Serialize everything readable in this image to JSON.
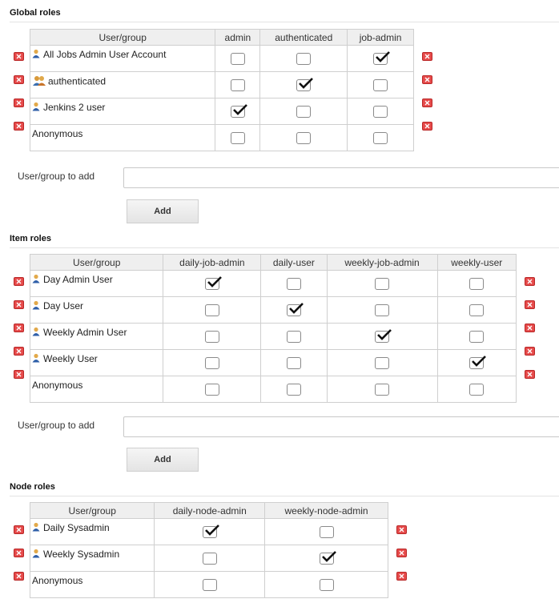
{
  "global": {
    "title": "Global roles",
    "columns": [
      "User/group",
      "admin",
      "authenticated",
      "job-admin"
    ],
    "rows": [
      {
        "name": "All Jobs Admin User Account",
        "icon": "user-icon",
        "checks": [
          false,
          false,
          true
        ]
      },
      {
        "name": "authenticated",
        "icon": "group-icon",
        "checks": [
          false,
          true,
          false
        ]
      },
      {
        "name": "Jenkins 2 user",
        "icon": "user-icon",
        "checks": [
          true,
          false,
          false
        ]
      },
      {
        "name": "Anonymous",
        "icon": "",
        "checks": [
          false,
          false,
          false
        ]
      }
    ],
    "add_label": "User/group to add",
    "add_value": "",
    "add_button": "Add"
  },
  "item": {
    "title": "Item roles",
    "columns": [
      "User/group",
      "daily-job-admin",
      "daily-user",
      "weekly-job-admin",
      "weekly-user"
    ],
    "rows": [
      {
        "name": "Day Admin User",
        "icon": "user-icon",
        "checks": [
          true,
          false,
          false,
          false
        ]
      },
      {
        "name": "Day User",
        "icon": "user-icon",
        "checks": [
          false,
          true,
          false,
          false
        ]
      },
      {
        "name": "Weekly Admin User",
        "icon": "user-icon",
        "checks": [
          false,
          false,
          true,
          false
        ]
      },
      {
        "name": "Weekly User",
        "icon": "user-icon",
        "checks": [
          false,
          false,
          false,
          true
        ]
      },
      {
        "name": "Anonymous",
        "icon": "",
        "checks": [
          false,
          false,
          false,
          false
        ]
      }
    ],
    "add_label": "User/group to add",
    "add_value": "",
    "add_button": "Add"
  },
  "node": {
    "title": "Node roles",
    "columns": [
      "User/group",
      "daily-node-admin",
      "weekly-node-admin"
    ],
    "rows": [
      {
        "name": "Daily Sysadmin",
        "icon": "user-icon",
        "checks": [
          true,
          false
        ]
      },
      {
        "name": "Weekly Sysadmin",
        "icon": "user-icon",
        "checks": [
          false,
          true
        ]
      },
      {
        "name": "Anonymous",
        "icon": "",
        "checks": [
          false,
          false
        ]
      }
    ]
  },
  "colors": {
    "delete": "#e64b4b",
    "header_bg": "#efefef",
    "border": "#cfcfcf"
  }
}
